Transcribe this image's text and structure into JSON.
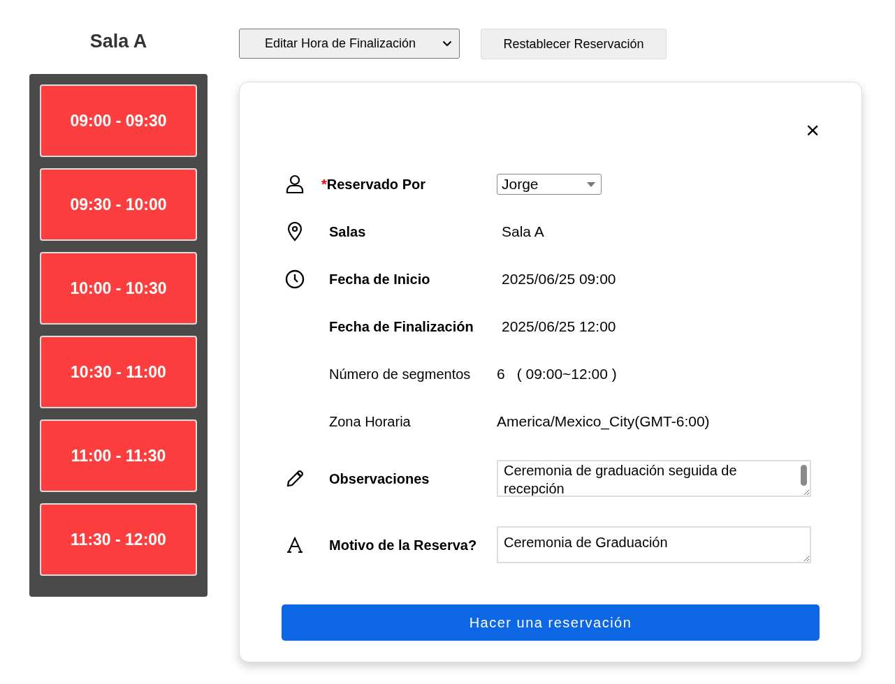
{
  "room_title": "Sala A",
  "end_time_dropdown": {
    "value": "Editar Hora de Finalización"
  },
  "reset_button": "Restablecer Reservación",
  "slots": [
    {
      "label": "09:00 - 09:30"
    },
    {
      "label": "09:30 - 10:00"
    },
    {
      "label": "10:00 - 10:30"
    },
    {
      "label": "10:30 - 11:00"
    },
    {
      "label": "11:00 - 11:30"
    },
    {
      "label": "11:30 - 12:00"
    }
  ],
  "dialog": {
    "close": "×",
    "fields": [
      {
        "kind": "select",
        "label": "Reservado Por",
        "required_mark": "*",
        "bold": true,
        "value": "Jorge"
      },
      {
        "kind": "text",
        "label": "Salas",
        "bold": true,
        "value": "Sala A"
      },
      {
        "kind": "text",
        "label": "Fecha de Inicio",
        "bold": true,
        "value": "2025/06/25 09:00"
      },
      {
        "kind": "text",
        "label": "Fecha de Finalización",
        "bold": true,
        "value": "2025/06/25 12:00"
      },
      {
        "kind": "segments",
        "label": "Número de segmentos",
        "bold": false,
        "value": "6",
        "range": "( 09:00~12:00 )"
      },
      {
        "kind": "plain",
        "label": "Zona Horaria",
        "bold": false,
        "value": "America/Mexico_City(GMT-6:00)"
      },
      {
        "kind": "textarea",
        "label": "Observaciones",
        "bold": true,
        "value": "Ceremonia de graduación seguida de recepción",
        "scrollbar": true
      },
      {
        "kind": "textarea",
        "label": "Motivo de la Reserva?",
        "bold": true,
        "value": "Ceremonia de Graduación",
        "scrollbar": false
      }
    ],
    "submit": "Hacer una reservación"
  }
}
